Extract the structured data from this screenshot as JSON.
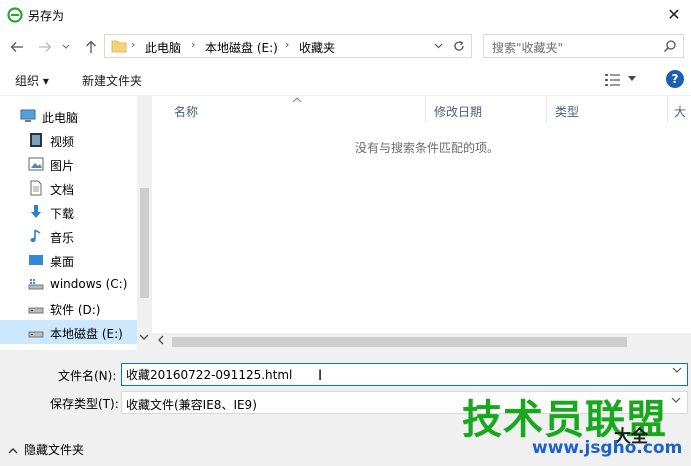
{
  "window": {
    "title": "另存为",
    "close": "✕"
  },
  "address": {
    "crumbs": [
      "此电脑",
      "本地磁盘 (E:)",
      "收藏夹"
    ]
  },
  "search": {
    "placeholder": "搜索\"收藏夹\""
  },
  "toolbar": {
    "organize": "组织 ▾",
    "new_folder": "新建文件夹"
  },
  "sidebar": {
    "items": [
      {
        "label": "此电脑",
        "icon": "computer-icon"
      },
      {
        "label": "视频",
        "icon": "video-icon"
      },
      {
        "label": "图片",
        "icon": "picture-icon"
      },
      {
        "label": "文档",
        "icon": "document-icon"
      },
      {
        "label": "下载",
        "icon": "download-icon"
      },
      {
        "label": "音乐",
        "icon": "music-icon"
      },
      {
        "label": "桌面",
        "icon": "desktop-icon"
      },
      {
        "label": "windows (C:)",
        "icon": "drive-icon"
      },
      {
        "label": "软件 (D:)",
        "icon": "drive-icon"
      },
      {
        "label": "本地磁盘 (E:)",
        "icon": "drive-icon",
        "selected": true
      }
    ]
  },
  "columns": [
    "名称",
    "修改日期",
    "类型",
    "大"
  ],
  "empty_message": "没有与搜索条件匹配的项。",
  "form": {
    "filename_label": "文件名(N):",
    "filename_value": "收藏20160722-091125.html",
    "filetype_label": "保存类型(T):",
    "filetype_value": "收藏文件(兼容IE8、IE9)"
  },
  "footer": {
    "hide_folders": "隐藏文件夹"
  },
  "watermark": {
    "main": "技术员联盟",
    "corner": "大全",
    "url": "www.jsgho.com"
  },
  "colors": {
    "selected": "#cce8ff",
    "accent": "#0078d7",
    "watermark_green": "#18a81e",
    "watermark_blue": "#1c63c9"
  }
}
